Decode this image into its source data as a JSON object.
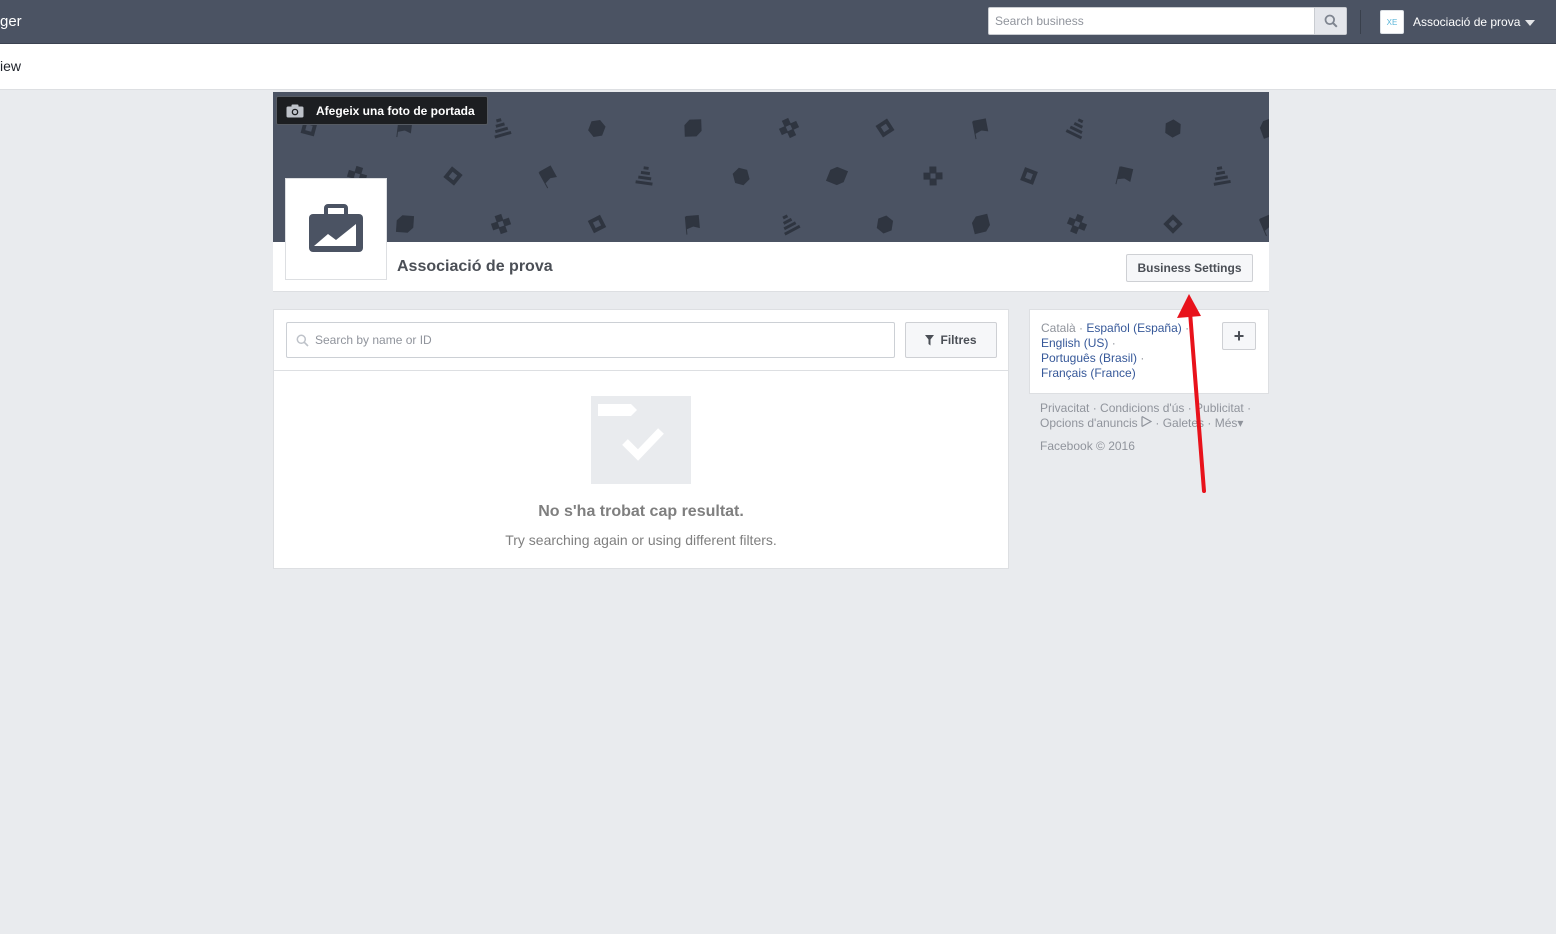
{
  "header": {
    "app_title": "ger",
    "search_placeholder": "Search business",
    "account_initials": "XE",
    "account_name": "Associació de prova"
  },
  "subbar": {
    "breadcrumb": "iew"
  },
  "cover": {
    "add_cover_label": "Afegeix una foto de portada"
  },
  "business": {
    "name": "Associació de prova",
    "settings_label": "Business Settings"
  },
  "list": {
    "search_placeholder": "Search by name or ID",
    "filter_label": "Filtres",
    "empty_title": "No s'ha trobat cap resultat.",
    "empty_subtitle": "Try searching again or using different filters."
  },
  "languages": {
    "current": "Català",
    "options": [
      "Español (España)",
      "English (US)",
      "Português (Brasil)",
      "Français (France)"
    ],
    "separator": "·",
    "add_label": "+"
  },
  "footer": {
    "links": [
      "Privacitat",
      "Condicions d'ús",
      "Publicitat",
      "Opcions d'anuncis",
      "Galetes",
      "Més"
    ],
    "copyright": "Facebook © 2016"
  },
  "colors": {
    "topbar": "#4b5363",
    "page_bg": "#e9ebee",
    "link": "#365899",
    "annotation_arrow": "#e8121b"
  }
}
